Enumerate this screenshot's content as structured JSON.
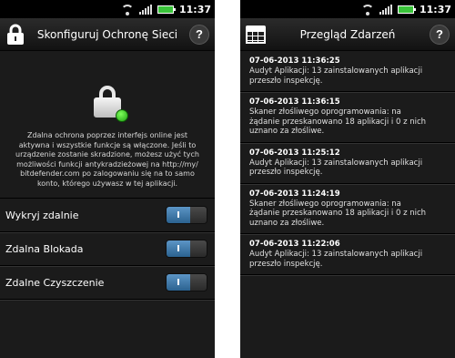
{
  "status": {
    "time": "11:37"
  },
  "left": {
    "title": "Skonfiguruj Ochronę Sieci",
    "help_label": "?",
    "description_lines": [
      "Zdalna ochrona poprzez interfejs online jest",
      "aktywna i wszystkie funkcje są włączone. Jeśli to",
      "urządzenie zostanie skradzione, możesz użyć tych",
      "możliwości funkcji antykradzieżowej na http://my/",
      "bitdefender.com po zalogowaniu się na to samo",
      "konto, którego używasz w tej aplikacji."
    ],
    "settings": [
      {
        "label": "Wykryj zdalnie",
        "toggle_label": "I",
        "on": true
      },
      {
        "label": "Zdalna Blokada",
        "toggle_label": "I",
        "on": true
      },
      {
        "label": "Zdalne Czyszczenie",
        "toggle_label": "I",
        "on": true
      }
    ]
  },
  "right": {
    "title": "Przegląd Zdarzeń",
    "help_label": "?",
    "events": [
      {
        "timestamp": "07-06-2013 11:36:25",
        "lines": [
          "Audyt Aplikacji: 13 zainstalowanych aplikacji",
          "przeszło inspekcję."
        ]
      },
      {
        "timestamp": "07-06-2013 11:36:15",
        "lines": [
          "Skaner złośliwego oprogramowania: na",
          "żądanie przeskanowano 18 aplikacji i 0 z nich",
          "uznano za złośliwe."
        ]
      },
      {
        "timestamp": "07-06-2013 11:25:12",
        "lines": [
          "Audyt Aplikacji: 13 zainstalowanych aplikacji",
          "przeszło inspekcję."
        ]
      },
      {
        "timestamp": "07-06-2013 11:24:19",
        "lines": [
          "Skaner złośliwego oprogramowania: na",
          "żądanie przeskanowano 18 aplikacji i 0 z nich",
          "uznano za złośliwe."
        ]
      },
      {
        "timestamp": "07-06-2013 11:22:06",
        "lines": [
          "Audyt Aplikacji: 13 zainstalowanych aplikacji",
          "przeszło inspekcję."
        ]
      }
    ]
  },
  "icons": {
    "wifi": "wifi-icon",
    "signal": "signal-icon",
    "battery": "battery-icon",
    "lock": "lock-icon",
    "calendar": "calendar-icon",
    "status_dot": "status-dot-icon"
  },
  "colors": {
    "toggle_on": "#3a78ad",
    "status_ok": "#2fbf1e",
    "battery": "#39c339"
  }
}
